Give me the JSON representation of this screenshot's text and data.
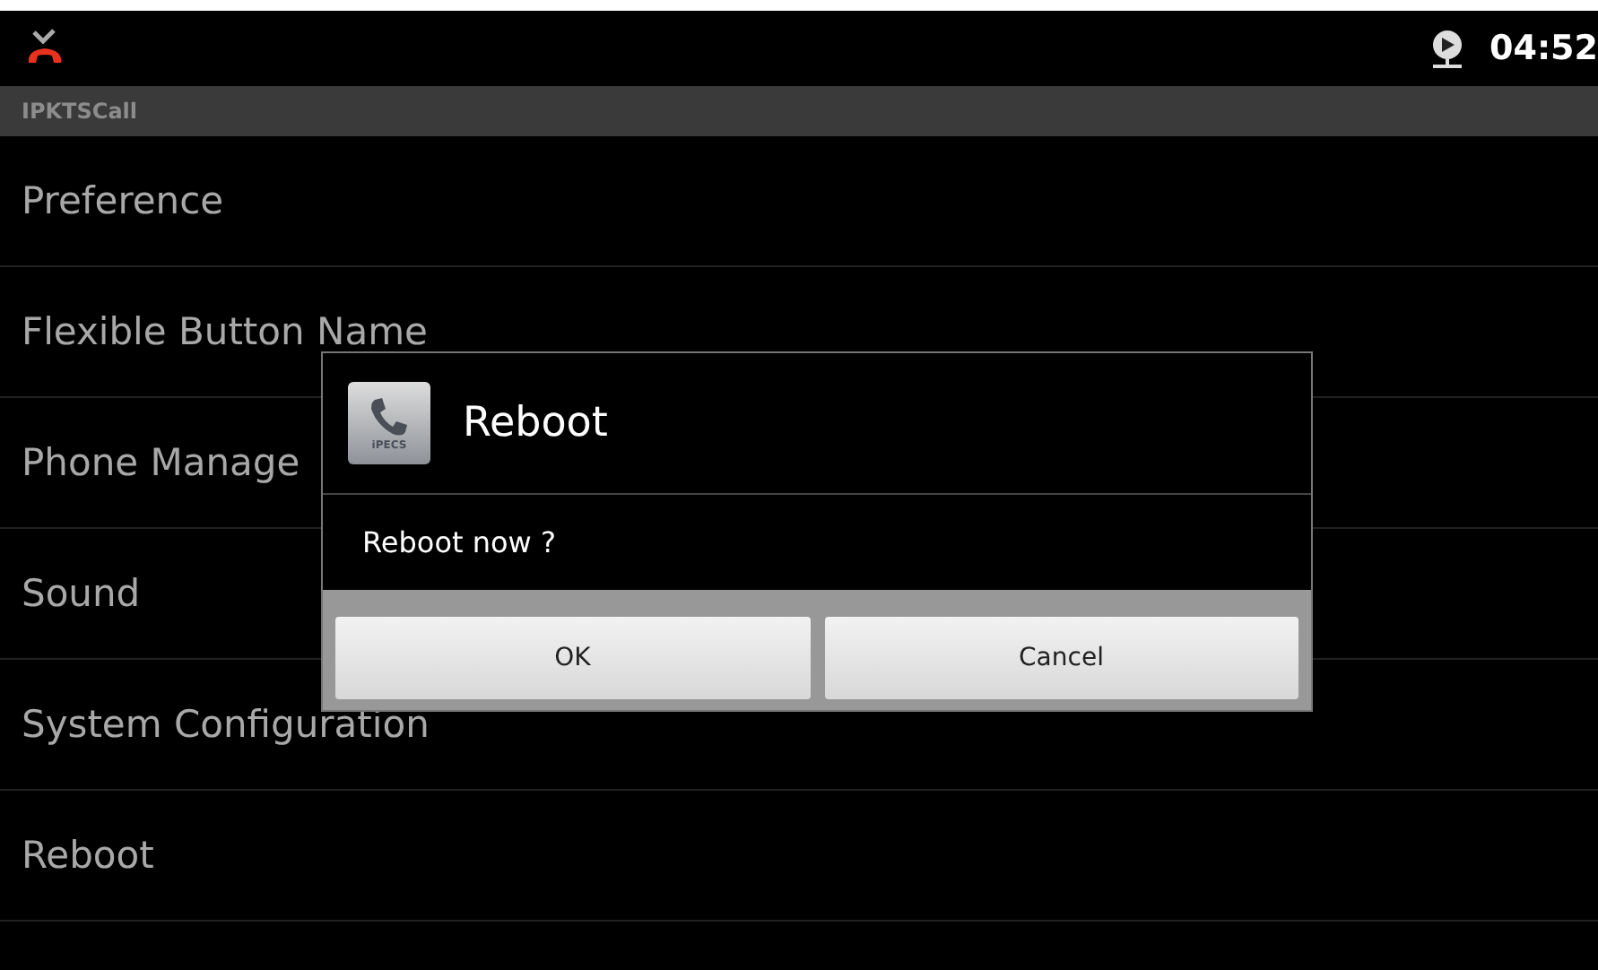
{
  "status_bar": {
    "time": "04:52"
  },
  "title_bar": {
    "title": "IPKTSCall"
  },
  "menu": [
    {
      "label": "Preference"
    },
    {
      "label": "Flexible Button Name"
    },
    {
      "label": "Phone Manage"
    },
    {
      "label": "Sound"
    },
    {
      "label": "System Configuration"
    },
    {
      "label": "Reboot"
    }
  ],
  "dialog": {
    "icon_text": "iPECS",
    "title": "Reboot",
    "message": "Reboot now ?",
    "buttons": [
      "OK",
      "Cancel"
    ]
  }
}
